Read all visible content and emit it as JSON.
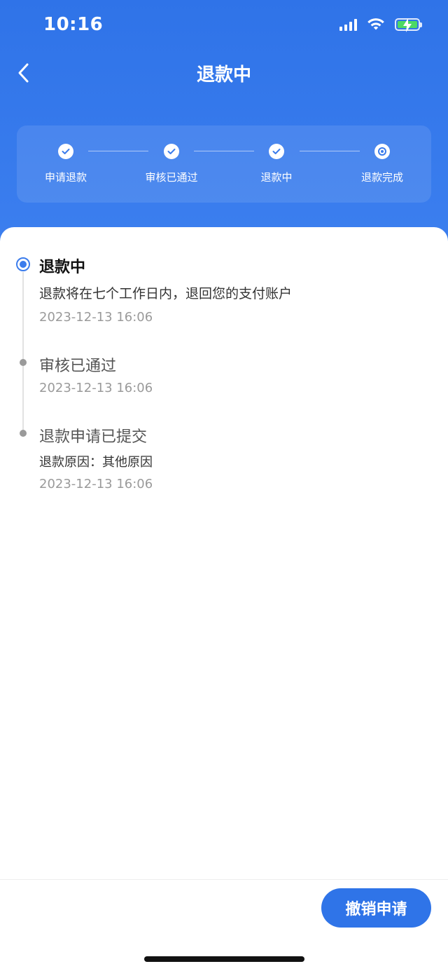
{
  "status_bar": {
    "time": "10:16"
  },
  "nav": {
    "title": "退款中",
    "back_icon": "chevron-left-icon"
  },
  "steps": [
    {
      "label": "申请退款",
      "state": "done"
    },
    {
      "label": "审核已通过",
      "state": "done"
    },
    {
      "label": "退款中",
      "state": "done"
    },
    {
      "label": "退款完成",
      "state": "current"
    }
  ],
  "timeline": [
    {
      "title": "退款中",
      "description": "退款将在七个工作日内，退回您的支付账户",
      "time": "2023-12-13 16:06",
      "current": true
    },
    {
      "title": "审核已通过",
      "time": "2023-12-13 16:06",
      "current": false
    },
    {
      "title": "退款申请已提交",
      "description": "退款原因：其他原因",
      "time": "2023-12-13 16:06",
      "current": false
    }
  ],
  "footer": {
    "cancel_label": "撤销申请"
  },
  "colors": {
    "primary": "#2f74e8",
    "accent_blue": "#3b7cec",
    "muted_text": "#9a9a9a",
    "battery_green": "#4cd964"
  }
}
